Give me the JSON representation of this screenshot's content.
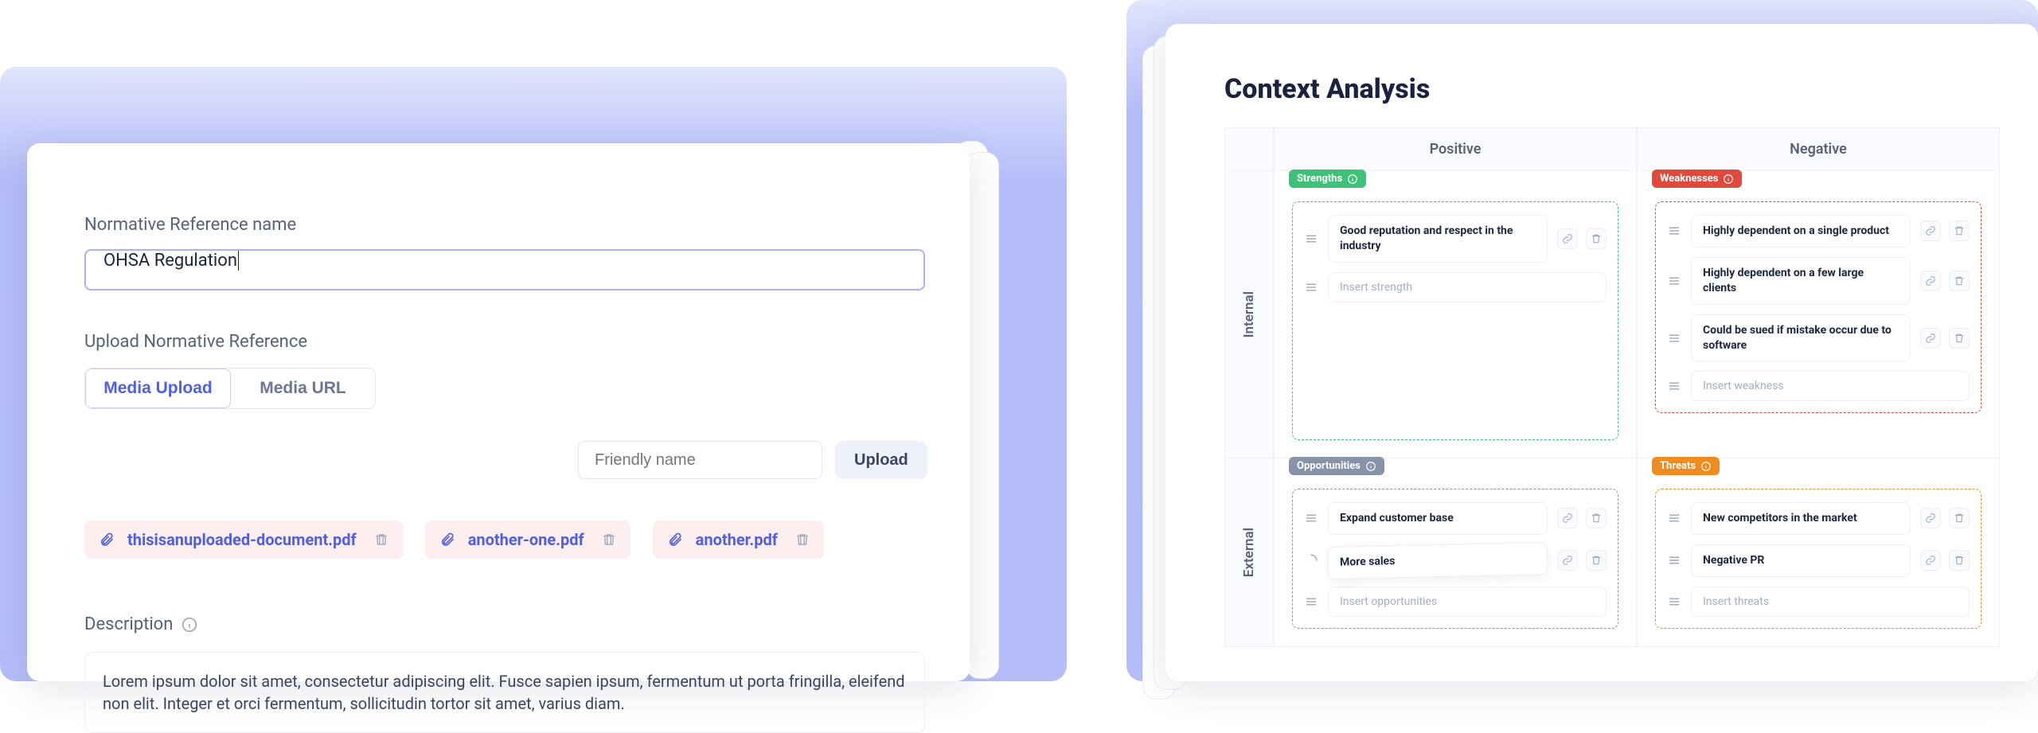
{
  "left": {
    "name_label": "Normative Reference name",
    "name_value": "OHSA Regulation",
    "upload_label": "Upload Normative Reference",
    "tab_media_upload": "Media Upload",
    "tab_media_url": "Media URL",
    "friendly_placeholder": "Friendly name",
    "upload_button": "Upload",
    "files": [
      "thisisanuploaded-document.pdf",
      "another-one.pdf",
      "another.pdf"
    ],
    "description_label": "Description",
    "description_text": "Lorem ipsum dolor sit amet, consectetur adipiscing elit. Fusce sapien ipsum, fermentum ut porta fringilla, eleifend non elit. Integer et orci fermentum, sollicitudin tortor sit amet, varius diam."
  },
  "right": {
    "title": "Context Analysis",
    "col_positive": "Positive",
    "col_negative": "Negative",
    "row_internal": "Internal",
    "row_external": "External",
    "tags": {
      "strengths": "Strengths",
      "weaknesses": "Weaknesses",
      "opportunities": "Opportunities",
      "threats": "Threats"
    },
    "strengths": {
      "items": [
        "Good reputation and respect in the industry"
      ],
      "placeholder": "Insert strength"
    },
    "weaknesses": {
      "items": [
        "Highly dependent on a single product",
        "Highly dependent on a few large clients",
        "Could be sued if mistake occur due to software"
      ],
      "placeholder": "Insert weakness"
    },
    "opportunities": {
      "items": [
        "Expand customer base",
        "More sales"
      ],
      "placeholder": "Insert opportunities"
    },
    "threats": {
      "items": [
        "New competitors in the market",
        "Negative PR"
      ],
      "placeholder": "Insert threats"
    }
  }
}
